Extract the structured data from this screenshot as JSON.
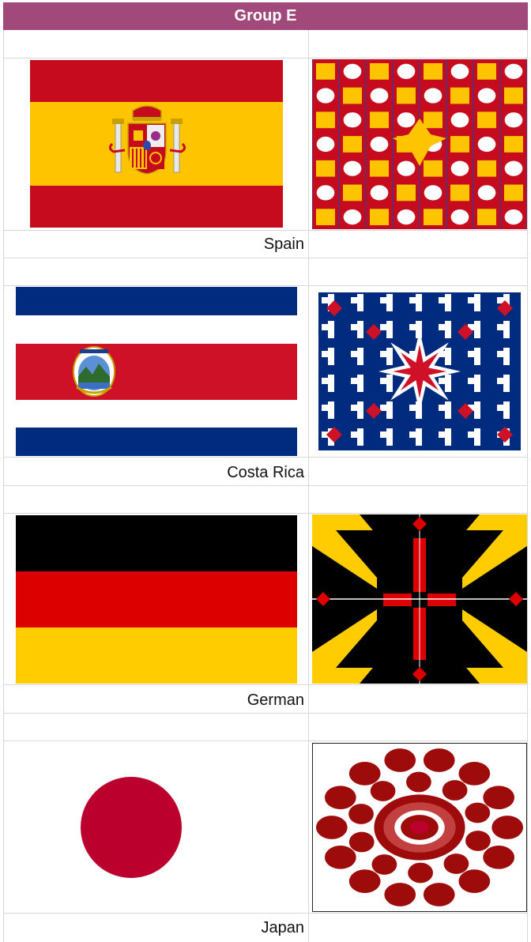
{
  "group": {
    "title": "Group E"
  },
  "countries": [
    {
      "name": "Spain",
      "flag_icon": "spain-flag-icon",
      "art_icon": "spain-pattern-art",
      "colors": [
        "#c60b1e",
        "#ffc400"
      ]
    },
    {
      "name": "Costa Rica",
      "flag_icon": "costa-rica-flag-icon",
      "art_icon": "costa-rica-pattern-art",
      "colors": [
        "#002b7f",
        "#ffffff",
        "#ce1126"
      ]
    },
    {
      "name": "German",
      "flag_icon": "germany-flag-icon",
      "art_icon": "germany-pattern-art",
      "colors": [
        "#000000",
        "#dd0000",
        "#ffcc00"
      ]
    },
    {
      "name": "Japan",
      "flag_icon": "japan-flag-icon",
      "art_icon": "japan-pattern-art",
      "colors": [
        "#ffffff",
        "#bc002d"
      ]
    }
  ]
}
